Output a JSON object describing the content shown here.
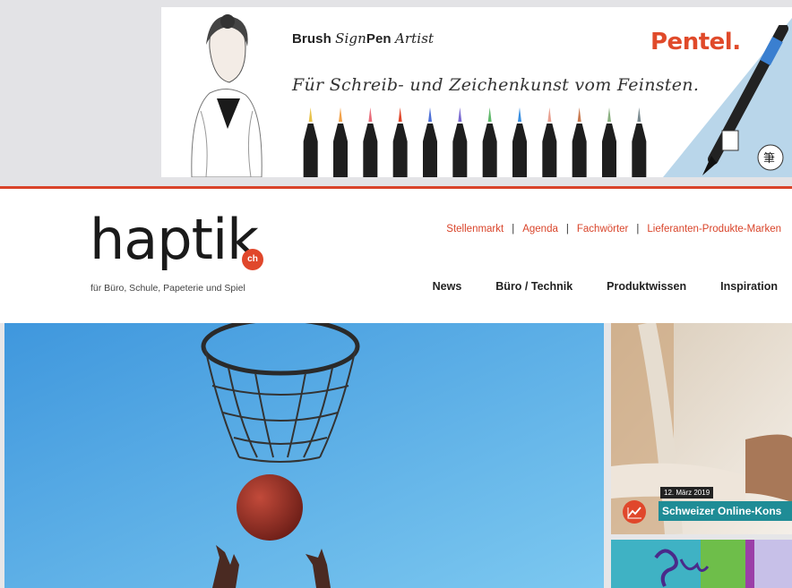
{
  "ad": {
    "title_prefix": "Brush",
    "title_sign": "Sign",
    "title_mid": "Pen",
    "title_artist": "Artist",
    "tagline": "Für Schreib- und Zeichenkunst vom Feinsten.",
    "brand": "Pentel",
    "brand_dot": ".",
    "pen_cap_colors": [
      "#e8c24a",
      "#f2a24a",
      "#e86c7a",
      "#e0472b",
      "#4d6fd6",
      "#7a6ad0",
      "#5fb86a",
      "#3a8fe0",
      "#e8a090",
      "#c87a50",
      "#8ab080",
      "#7a8a90"
    ]
  },
  "header": {
    "logo": "haptik",
    "logo_badge": "ch",
    "tagline": "für Büro, Schule, Papeterie und Spiel",
    "top_links": [
      "Stellenmarkt",
      "Agenda",
      "Fachwörter",
      "Lieferanten-Produkte-Marken"
    ],
    "nav": [
      "News",
      "Büro / Technik",
      "Produktwissen",
      "Inspiration"
    ]
  },
  "side_article": {
    "date": "12. März 2019",
    "headline": "Schweizer Online-Kons"
  },
  "colors": {
    "accent": "#d9442a",
    "teal": "#1f8c96",
    "sky": "#5aaee8"
  }
}
